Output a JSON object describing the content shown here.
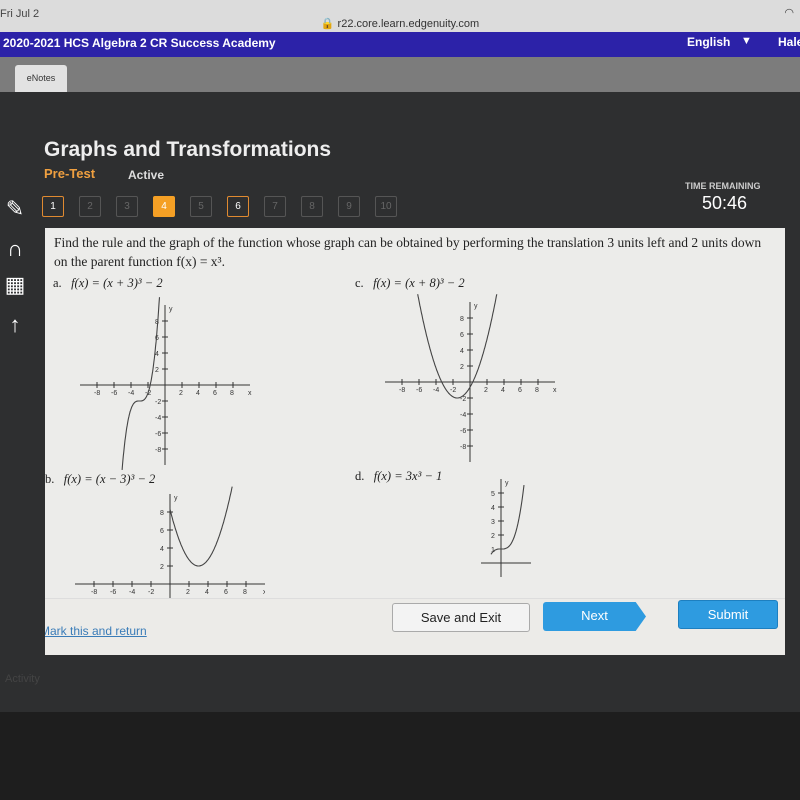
{
  "status_bar": {
    "date": "Fri Jul 2",
    "url": "r22.core.learn.edgenuity.com"
  },
  "header": {
    "course": "2020-2021 HCS Algebra 2 CR Success Academy",
    "language": "English",
    "user": "Hale"
  },
  "tabs": [
    {
      "label": "eNotes"
    }
  ],
  "activity": {
    "title": "Graphs and Transformations",
    "type": "Pre-Test",
    "status": "Active",
    "time_label": "TIME REMAINING",
    "time": "50:46"
  },
  "questions": [
    {
      "n": "1",
      "state": "visited"
    },
    {
      "n": "2",
      "state": "unvisited"
    },
    {
      "n": "3",
      "state": "unvisited"
    },
    {
      "n": "4",
      "state": "current"
    },
    {
      "n": "5",
      "state": "unvisited"
    },
    {
      "n": "6",
      "state": "visited"
    },
    {
      "n": "7",
      "state": "unvisited"
    },
    {
      "n": "8",
      "state": "unvisited"
    },
    {
      "n": "9",
      "state": "unvisited"
    },
    {
      "n": "10",
      "state": "unvisited"
    }
  ],
  "sidebar_icons": [
    "pencil-icon",
    "headphones-icon",
    "calculator-icon",
    "arrow-up-icon"
  ],
  "question": {
    "text": "Find the rule and the graph of the function whose graph can be obtained by performing the translation 3 units left and 2 units down on the parent function f(x) = x³.",
    "options": [
      {
        "letter": "a.",
        "rule": "f(x) = (x + 3)³ − 2",
        "x_ticks": [
          "-8",
          "-6",
          "-4",
          "-2",
          "2",
          "4",
          "6",
          "8"
        ],
        "y_ticks": [
          "8",
          "6",
          "4",
          "2",
          "-2",
          "-4",
          "-6",
          "-8"
        ],
        "x_label": "x",
        "y_label": "y"
      },
      {
        "letter": "b.",
        "rule": "f(x) = (x − 3)³ − 2",
        "x_ticks": [
          "-8",
          "-6",
          "-4",
          "-2",
          "2",
          "4",
          "6",
          "8"
        ],
        "y_ticks": [
          "8",
          "6",
          "4",
          "2"
        ],
        "x_label": "x",
        "y_label": "y"
      },
      {
        "letter": "c.",
        "rule": "f(x) = (x + 8)³ − 2",
        "x_ticks": [
          "-8",
          "-6",
          "-4",
          "-2",
          "2",
          "4",
          "6",
          "8"
        ],
        "y_ticks": [
          "8",
          "6",
          "4",
          "2",
          "-2",
          "-4",
          "-6",
          "-8"
        ],
        "x_label": "x",
        "y_label": "y"
      },
      {
        "letter": "d.",
        "rule": "f(x) = 3x³ − 1",
        "x_ticks": [],
        "y_ticks": [
          "5",
          "4",
          "3",
          "2",
          "1"
        ],
        "x_label": "",
        "y_label": "y"
      }
    ]
  },
  "footer": {
    "mark": "Mark this and return",
    "save": "Save and Exit",
    "next": "Next",
    "submit": "Submit"
  },
  "bottom": {
    "activity": "Activity"
  },
  "colors": {
    "header": "#2c22a8",
    "accent": "#f5a025",
    "button": "#2e9be0"
  }
}
